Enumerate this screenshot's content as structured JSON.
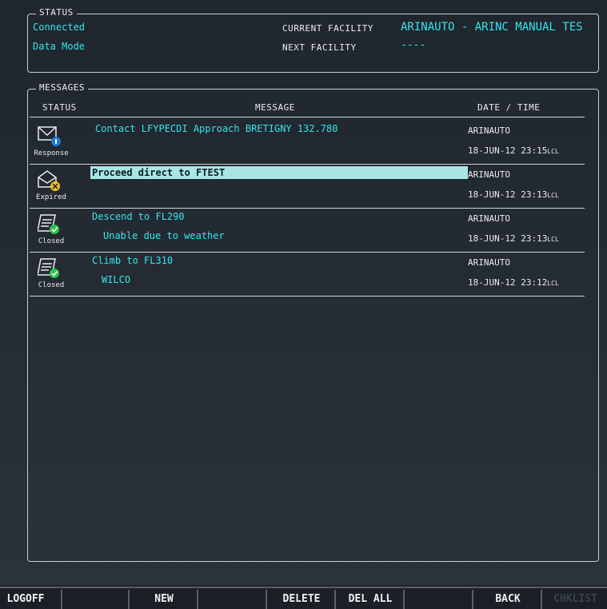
{
  "status": {
    "title": "STATUS",
    "connection": "Connected",
    "mode": "Data Mode",
    "current_facility_label": "CURRENT FACILITY",
    "current_facility_value": "ARINAUTO - ARINC MANUAL TES",
    "next_facility_label": "NEXT FACILITY",
    "next_facility_value": "----"
  },
  "messages": {
    "title": "MESSAGES",
    "columns": {
      "status": "STATUS",
      "message": "MESSAGE",
      "datetime": "DATE / TIME"
    },
    "rows": [
      {
        "state": "Response",
        "icon": "envelope-info-icon",
        "text": "Contact LFYPECDI Approach BRETIGNY 132.780",
        "sub": "",
        "from": "ARINAUTO",
        "date": "18-JUN-12 23:15",
        "tz": "LCL"
      },
      {
        "state": "Expired",
        "icon": "envelope-expired-icon",
        "text": "Proceed direct to FTEST",
        "sub": "",
        "from": "ARINAUTO",
        "date": "18-JUN-12 23:13",
        "tz": "LCL"
      },
      {
        "state": "Closed",
        "icon": "closed-check-icon",
        "text": "Descend to FL290",
        "sub": "Unable due to weather",
        "from": "ARINAUTO",
        "date": "18-JUN-12 23:13",
        "tz": "LCL"
      },
      {
        "state": "Closed",
        "icon": "closed-check-icon",
        "text": "Climb to FL310",
        "sub": "WILCO",
        "from": "ARINAUTO",
        "date": "18-JUN-12 23:12",
        "tz": "LCL"
      }
    ]
  },
  "softkeys": [
    "LOGOFF",
    "",
    "NEW",
    "",
    "DELETE",
    "DEL ALL",
    "",
    "BACK",
    "CHKLIST"
  ],
  "colors": {
    "cyan": "#34e4ec",
    "highlight": "#a8e6e6",
    "status_ok": "#2fc24a",
    "status_warn": "#f4c21a",
    "status_info": "#1e78d8"
  }
}
